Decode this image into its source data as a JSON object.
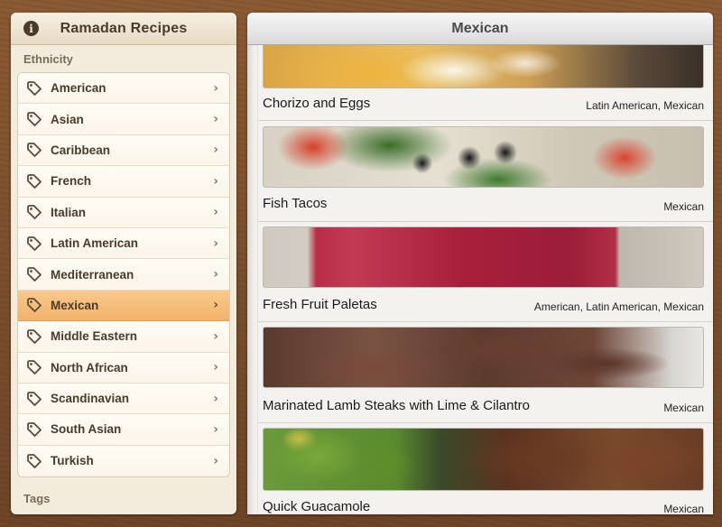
{
  "sidebar": {
    "title": "Ramadan Recipes",
    "info_icon": "i",
    "section_ethnicity": "Ethnicity",
    "section_tags": "Tags",
    "selected_index": 7,
    "items": [
      {
        "label": "American"
      },
      {
        "label": "Asian"
      },
      {
        "label": "Caribbean"
      },
      {
        "label": "French"
      },
      {
        "label": "Italian"
      },
      {
        "label": "Latin American"
      },
      {
        "label": "Mediterranean"
      },
      {
        "label": "Mexican"
      },
      {
        "label": "Middle Eastern"
      },
      {
        "label": "North African"
      },
      {
        "label": "Scandinavian"
      },
      {
        "label": "South Asian"
      },
      {
        "label": "Turkish"
      }
    ]
  },
  "main": {
    "title": "Mexican",
    "recipes": [
      {
        "name": "Chorizo and Eggs",
        "tags": "Latin American, Mexican",
        "image": "img-eggs"
      },
      {
        "name": "Fish Tacos",
        "tags": "Mexican",
        "image": "img-tacos"
      },
      {
        "name": "Fresh Fruit Paletas",
        "tags": "American, Latin American, Mexican",
        "image": "img-paletas"
      },
      {
        "name": "Marinated Lamb Steaks with Lime & Cilantro",
        "tags": "Mexican",
        "image": "img-lamb"
      },
      {
        "name": "Quick Guacamole",
        "tags": "Mexican",
        "image": "img-guac"
      }
    ]
  },
  "colors": {
    "selected_row": "#f1b26b",
    "sidebar_bg": "#f3ebdc",
    "wood": "#7a4f2c"
  }
}
